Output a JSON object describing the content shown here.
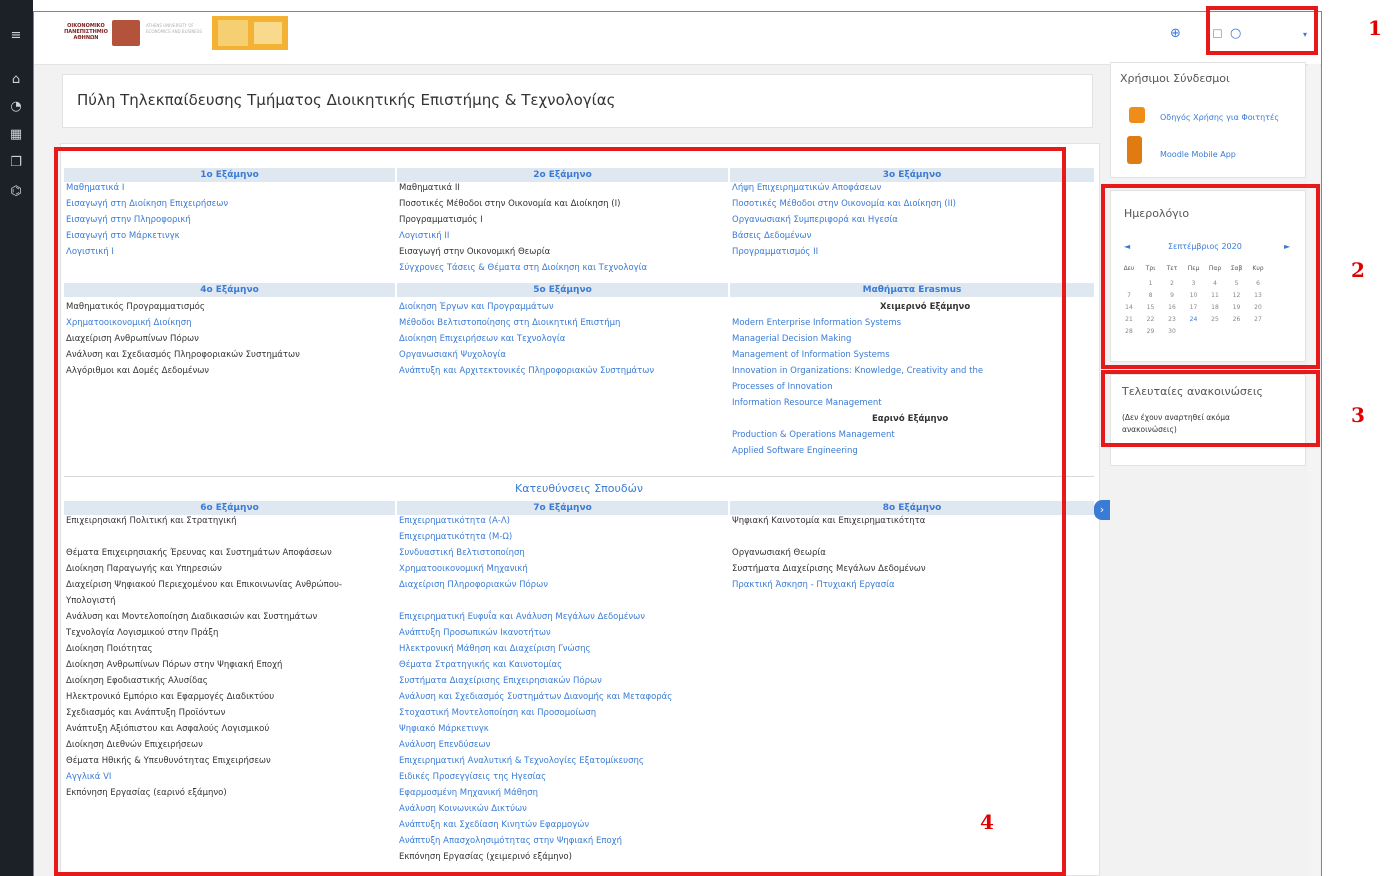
{
  "header": {
    "logo_text": "ΟΙΚΟΝΟΜΙΚΟ ΠΑΝΕΠΙΣΤΗΜΙΟ ΑΘΗΝΩΝ",
    "logo_text_en": "ATHENS UNIVERSITY OF ECONOMICS AND BUSINESS"
  },
  "page_title": "Πύλη Τηλεκπαίδευσης Τμήματος Διοικητικής Επιστήμης & Τεχνολογίας",
  "semesters_top": [
    {
      "title": "1ο Εξάμηνο",
      "courses": [
        {
          "name": "Μαθηματικά Ι",
          "link": true
        },
        {
          "name": "Εισαγωγή στη Διοίκηση Επιχειρήσεων",
          "link": true
        },
        {
          "name": "Εισαγωγή στην Πληροφορική",
          "link": true
        },
        {
          "name": "Εισαγωγή στο Μάρκετινγκ",
          "link": true
        },
        {
          "name": "Λογιστική Ι",
          "link": true
        }
      ]
    },
    {
      "title": "2ο Εξάμηνο",
      "courses": [
        {
          "name": "Μαθηματικά ΙΙ",
          "link": false
        },
        {
          "name": "Ποσοτικές Μέθοδοι στην Οικονομία και Διοίκηση (Ι)",
          "link": false
        },
        {
          "name": "Προγραμματισμός Ι",
          "link": false
        },
        {
          "name": "Λογιστική ΙΙ",
          "link": true
        },
        {
          "name": "Εισαγωγή στην Οικονομική Θεωρία",
          "link": false
        },
        {
          "name": "Σύγχρονες Τάσεις & Θέματα στη Διοίκηση και Τεχνολογία",
          "link": true
        }
      ]
    },
    {
      "title": "3ο Εξάμηνο",
      "courses": [
        {
          "name": "Λήψη Επιχειρηματικών Αποφάσεων",
          "link": true
        },
        {
          "name": "Ποσοτικές Μέθοδοι στην Οικονομία και Διοίκηση (ΙΙ)",
          "link": true
        },
        {
          "name": "Οργανωσιακή Συμπεριφορά και Ηγεσία",
          "link": true
        },
        {
          "name": "Βάσεις Δεδομένων",
          "link": true
        },
        {
          "name": "Προγραμματισμός ΙΙ",
          "link": true
        }
      ]
    }
  ],
  "semesters_mid": [
    {
      "title": "4ο Εξάμηνο",
      "courses": [
        {
          "name": "Μαθηματικός Προγραμματισμός",
          "link": false
        },
        {
          "name": "Χρηματοοικονομική Διοίκηση",
          "link": true
        },
        {
          "name": "Διαχείριση Ανθρωπίνων Πόρων",
          "link": false
        },
        {
          "name": "Ανάλυση και Σχεδιασμός Πληροφοριακών Συστημάτων",
          "link": false
        },
        {
          "name": "Αλγόριθμοι και Δομές Δεδομένων",
          "link": false
        }
      ]
    },
    {
      "title": "5ο Εξάμηνο",
      "courses": [
        {
          "name": "Διοίκηση Έργων και Προγραμμάτων",
          "link": true
        },
        {
          "name": "Μέθοδοι Βελτιστοποίησης στη Διοικητική Επιστήμη",
          "link": true
        },
        {
          "name": "Διοίκηση Επιχειρήσεων και Τεχνολογία",
          "link": true
        },
        {
          "name": "Οργανωσιακή Ψυχολογία",
          "link": true
        },
        {
          "name": "Ανάπτυξη και Αρχιτεκτονικές Πληροφοριακών Συστημάτων",
          "link": true
        }
      ]
    },
    {
      "title": "Μαθήματα Erasmus",
      "winter": "Χειμερινό Εξάμηνο",
      "spring": "Εαρινό Εξάμηνο",
      "winter_courses": [
        "Modern Enterprise Information Systems",
        "Managerial Decision Making",
        "Management of Information Systems",
        "Innovation in Organizations: Knowledge, Creativity and the",
        "Processes of Innovation",
        "Information Resource Management"
      ],
      "spring_courses": [
        "Production & Operations Management",
        "Applied Software Engineering"
      ]
    }
  ],
  "directions_title": "Κατευθύνσεις Σπουδών",
  "semesters_bottom": [
    {
      "title": "6ο Εξάμηνο",
      "courses": [
        {
          "name": "Επιχειρησιακή Πολιτική και Στρατηγική",
          "link": false
        },
        {
          "name": "",
          "link": false
        },
        {
          "name": "Θέματα Επιχειρησιακής Έρευνας και Συστημάτων Αποφάσεων",
          "link": false
        },
        {
          "name": "Διοίκηση Παραγωγής και Υπηρεσιών",
          "link": false
        },
        {
          "name": "Διαχείριση Ψηφιακού Περιεχομένου και Επικοινωνίας Ανθρώπου-",
          "link": false
        },
        {
          "name": "Υπολογιστή",
          "link": false
        },
        {
          "name": "Ανάλυση και Μοντελοποίηση Διαδικασιών και Συστημάτων",
          "link": false
        },
        {
          "name": "Τεχνολογία Λογισμικού στην Πράξη",
          "link": false
        },
        {
          "name": "Διοίκηση Ποιότητας",
          "link": false
        },
        {
          "name": "Διοίκηση Ανθρωπίνων Πόρων στην Ψηφιακή Εποχή",
          "link": false
        },
        {
          "name": "Διοίκηση Εφοδιαστικής Αλυσίδας",
          "link": false
        },
        {
          "name": "Ηλεκτρονικό Εμπόριο και Εφαρμογές Διαδικτύου",
          "link": false
        },
        {
          "name": "Σχεδιασμός και Ανάπτυξη Προϊόντων",
          "link": false
        },
        {
          "name": "Ανάπτυξη Αξιόπιστου και Ασφαλούς Λογισμικού",
          "link": false
        },
        {
          "name": "Διοίκηση Διεθνών Επιχειρήσεων",
          "link": false
        },
        {
          "name": "Θέματα Ηθικής & Υπευθυνότητας Επιχειρήσεων",
          "link": false
        },
        {
          "name": "Αγγλικά VI",
          "link": true
        },
        {
          "name": "Εκπόνηση Εργασίας (εαρινό εξάμηνο)",
          "link": false
        }
      ]
    },
    {
      "title": "7ο Εξάμηνο",
      "courses": [
        {
          "name": "Επιχειρηματικότητα (Α-Λ)",
          "link": true
        },
        {
          "name": "Επιχειρηματικότητα (Μ-Ω)",
          "link": true
        },
        {
          "name": "Συνδυαστική Βελτιστοποίηση",
          "link": true
        },
        {
          "name": "Χρηματοοικονομική Μηχανική",
          "link": true
        },
        {
          "name": "Διαχείριση Πληροφοριακών Πόρων",
          "link": true
        },
        {
          "name": "",
          "link": false
        },
        {
          "name": "Επιχειρηματική Ευφυΐα και Ανάλυση Μεγάλων Δεδομένων",
          "link": true
        },
        {
          "name": "Ανάπτυξη Προσωπικών Ικανοτήτων",
          "link": true
        },
        {
          "name": "Ηλεκτρονική Μάθηση και Διαχείριση Γνώσης",
          "link": true
        },
        {
          "name": "Θέματα Στρατηγικής και Καινοτομίας",
          "link": true
        },
        {
          "name": "Συστήματα Διαχείρισης Επιχειρησιακών Πόρων",
          "link": true
        },
        {
          "name": "Ανάλυση και Σχεδιασμός Συστημάτων Διανομής και Μεταφοράς",
          "link": true
        },
        {
          "name": "Στοχαστική Μοντελοποίηση και Προσομοίωση",
          "link": true
        },
        {
          "name": "Ψηφιακό Μάρκετινγκ",
          "link": true
        },
        {
          "name": "Ανάλυση Επενδύσεων",
          "link": true
        },
        {
          "name": "Επιχειρηματική Αναλυτική & Τεχνολογίες Εξατομίκευσης",
          "link": true
        },
        {
          "name": "Ειδικές Προσεγγίσεις της Ηγεσίας",
          "link": true
        },
        {
          "name": "Εφαρμοσμένη Μηχανική Μάθηση",
          "link": true
        },
        {
          "name": "Ανάλυση Κοινωνικών Δικτύων",
          "link": true
        },
        {
          "name": "Ανάπτυξη και Σχεδίαση Κινητών Εφαρμογών",
          "link": true
        },
        {
          "name": "Ανάπτυξη Απασχολησιμότητας στην Ψηφιακή Εποχή",
          "link": true
        },
        {
          "name": "Εκπόνηση Εργασίας (χειμερινό εξάμηνο)",
          "link": false
        }
      ]
    },
    {
      "title": "8ο Εξάμηνο",
      "courses": [
        {
          "name": "Ψηφιακή Καινοτομία και Επιχειρηματικότητα",
          "link": false
        },
        {
          "name": "",
          "link": false
        },
        {
          "name": "Οργανωσιακή Θεωρία",
          "link": false
        },
        {
          "name": "Συστήματα Διαχείρισης Μεγάλων Δεδομένων",
          "link": false
        },
        {
          "name": "Πρακτική Άσκηση - Πτυχιακή Εργασία",
          "link": true
        }
      ]
    }
  ],
  "right_panel": {
    "links_title": "Χρήσιμοι Σύνδεσμοι",
    "link1": "Οδηγός Χρήσης για Φοιτητές",
    "link2": "Moodle Mobile App",
    "calendar_title": "Ημερολόγιο",
    "month": "Σεπτέμβριος 2020",
    "prev": "◄",
    "next": "►",
    "weekdays": [
      "Δευ",
      "Τρι",
      "Τετ",
      "Πεμ",
      "Παρ",
      "Σαβ",
      "Κυρ"
    ],
    "weeks": [
      [
        "",
        "1",
        "2",
        "3",
        "4",
        "5",
        "6"
      ],
      [
        "7",
        "8",
        "9",
        "10",
        "11",
        "12",
        "13"
      ],
      [
        "14",
        "15",
        "16",
        "17",
        "18",
        "19",
        "20"
      ],
      [
        "21",
        "22",
        "23",
        "24",
        "25",
        "26",
        "27"
      ],
      [
        "28",
        "29",
        "30",
        "",
        "",
        "",
        ""
      ]
    ],
    "news_title": "Τελευταίες ανακοινώσεις",
    "news_empty": "(Δεν έχουν αναρτηθεί ακόμα ανακοινώσεις)"
  },
  "annotations": [
    "1",
    "2",
    "3",
    "4"
  ],
  "colors": {
    "accent": "#3a7bd5",
    "annotation": "#e61a1a",
    "sidebar": "#1c2027"
  }
}
